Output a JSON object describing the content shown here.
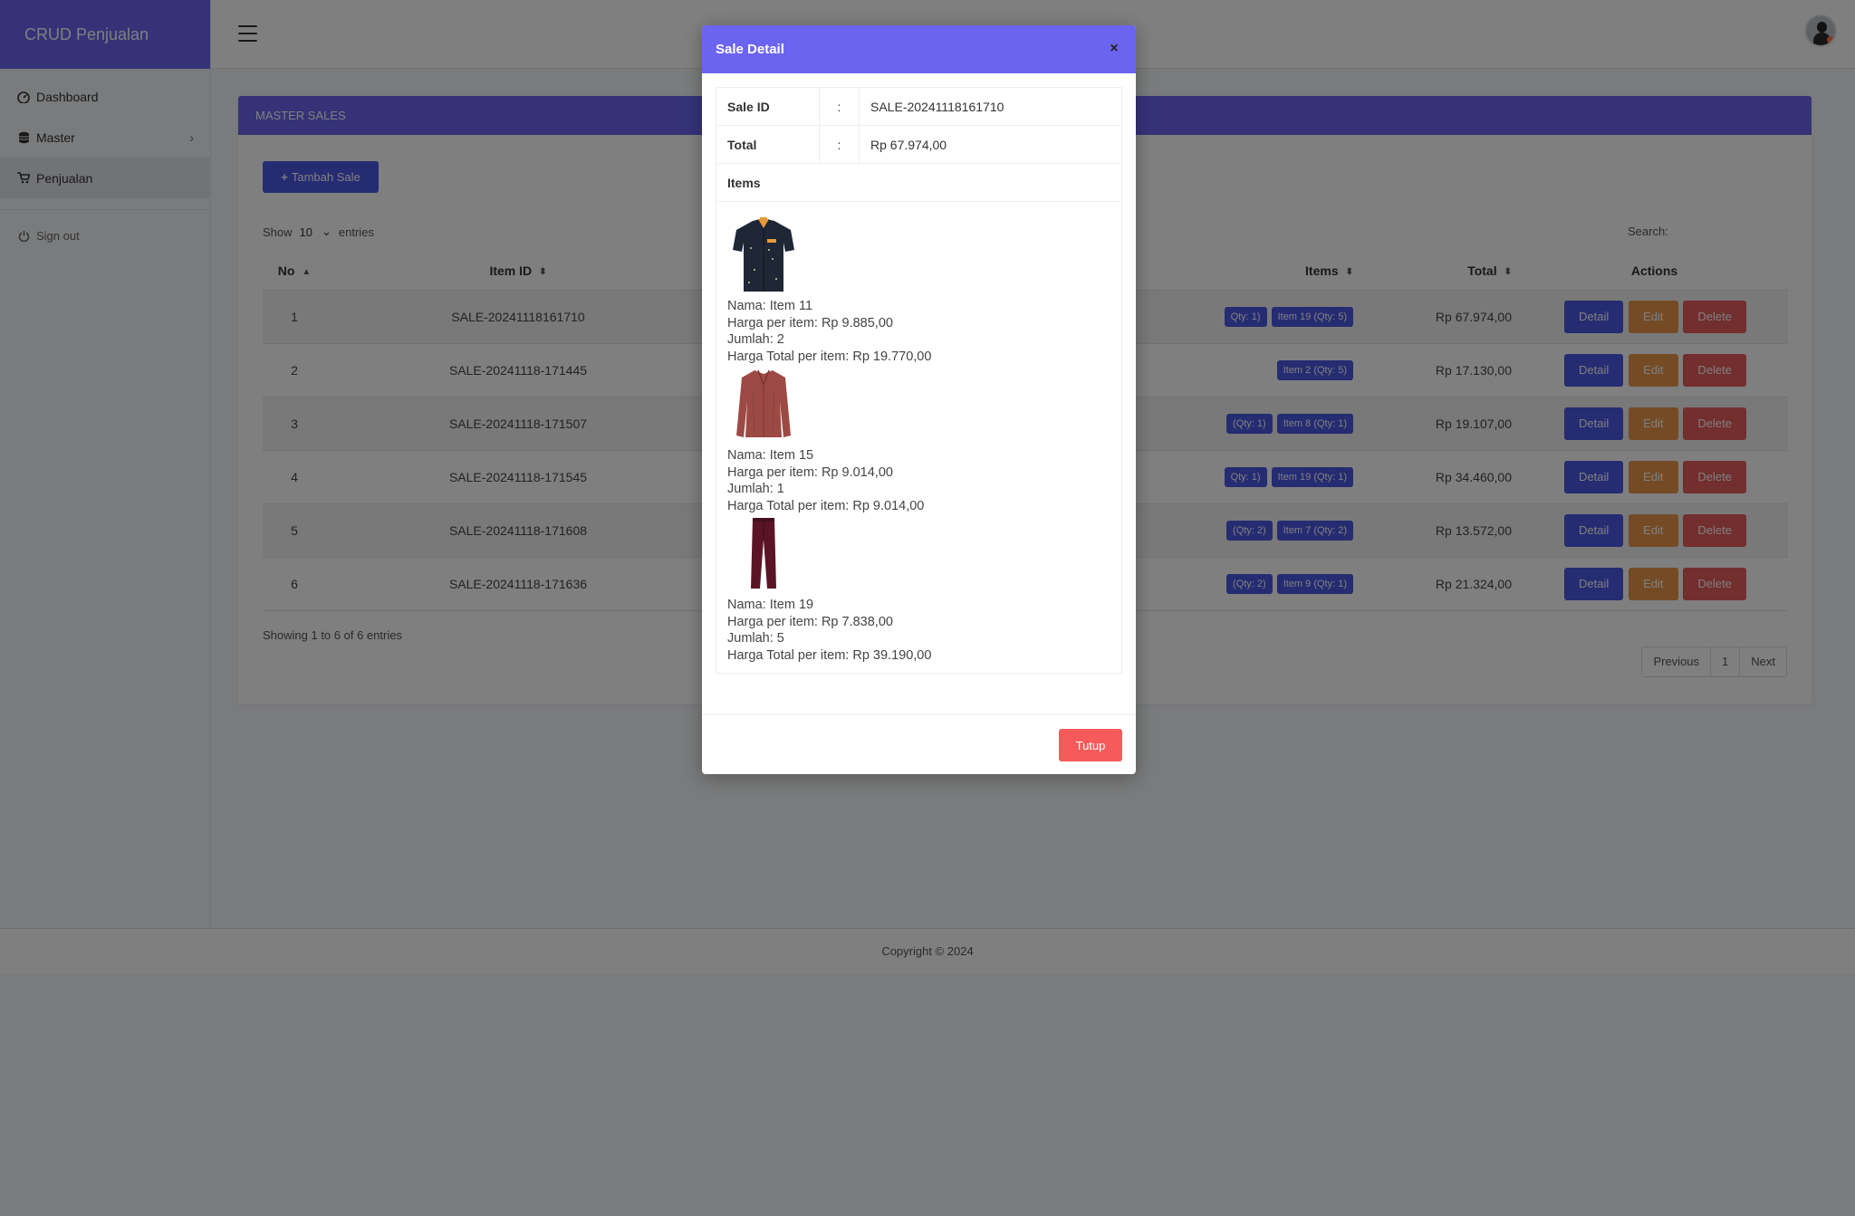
{
  "sidebar": {
    "brand": "CRUD Penjualan",
    "items": [
      {
        "label": "Dashboard",
        "icon": "dashboard-icon"
      },
      {
        "label": "Master",
        "icon": "database-icon"
      },
      {
        "label": "Penjualan",
        "icon": "cart-icon"
      }
    ],
    "signout": "Sign out"
  },
  "card": {
    "header": "MASTER SALES",
    "add_button": "Tambah Sale",
    "show": "Show",
    "entries_value": "10",
    "entries": "entries",
    "search_label": "Search:"
  },
  "table": {
    "columns": [
      "No",
      "Item ID",
      "Items",
      "Total",
      "Actions"
    ],
    "rows": [
      {
        "no": "1",
        "id": "SALE-20241118161710",
        "b1": "Qty: 1)",
        "b2": "Item 19 (Qty: 5)",
        "total": "Rp 67.974,00"
      },
      {
        "no": "2",
        "id": "SALE-20241118-171445",
        "b1": "",
        "b2": "Item 2 (Qty: 5)",
        "total": "Rp 17.130,00"
      },
      {
        "no": "3",
        "id": "SALE-20241118-171507",
        "b1": "(Qty: 1)",
        "b2": "Item 8 (Qty: 1)",
        "total": "Rp 19.107,00"
      },
      {
        "no": "4",
        "id": "SALE-20241118-171545",
        "b1": "Qty: 1)",
        "b2": "Item 19 (Qty: 1)",
        "total": "Rp 34.460,00"
      },
      {
        "no": "5",
        "id": "SALE-20241118-171608",
        "b1": "(Qty: 2)",
        "b2": "Item 7 (Qty: 2)",
        "total": "Rp 13.572,00"
      },
      {
        "no": "6",
        "id": "SALE-20241118-171636",
        "b1": "(Qty: 2)",
        "b2": "Item 9 (Qty: 1)",
        "total": "Rp 21.324,00"
      }
    ],
    "actions": {
      "detail": "Detail",
      "edit": "Edit",
      "delete": "Delete"
    },
    "info": "Showing 1 to 6 of 6 entries",
    "pager": {
      "prev": "Previous",
      "page": "1",
      "next": "Next"
    }
  },
  "footer": "Copyright © 2024",
  "modal": {
    "title": "Sale Detail",
    "close": "×",
    "sale_id_label": "Sale ID",
    "sale_id": "SALE-20241118161710",
    "total_label": "Total",
    "total": "Rp 67.974,00",
    "colon": ":",
    "items_label": "Items",
    "items": [
      {
        "nama": "Nama: Item 11",
        "harga": "Harga per item: Rp 9.885,00",
        "jumlah": "Jumlah: 2",
        "total": "Harga Total per item: Rp 19.770,00",
        "image": "shirt-image"
      },
      {
        "nama": "Nama: Item 15",
        "harga": "Harga per item: Rp 9.014,00",
        "jumlah": "Jumlah: 1",
        "total": "Harga Total per item: Rp 9.014,00",
        "image": "blouse-image"
      },
      {
        "nama": "Nama: Item 19",
        "harga": "Harga per item: Rp 7.838,00",
        "jumlah": "Jumlah: 5",
        "total": "Harga Total per item: Rp 39.190,00",
        "image": "trousers-image"
      }
    ],
    "tutup": "Tutup"
  },
  "colors": {
    "primary": "#6a64f1",
    "button_blue": "#4a58e4",
    "edit": "#e8964a",
    "delete": "#e65c5c",
    "tutup": "#f75a5a"
  }
}
